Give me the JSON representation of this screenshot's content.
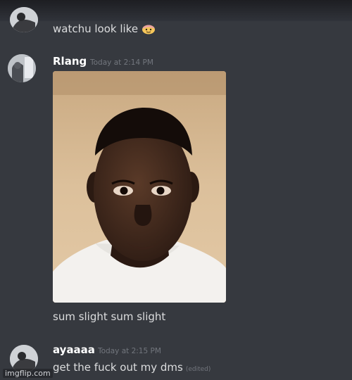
{
  "messages": [
    {
      "text": "watchu look like",
      "emoji": "face-with-party-hat-emoji"
    },
    {
      "username": "Rlang",
      "timestamp": "Today at 2:14 PM",
      "attachment": "selfie-photo",
      "text": "sum slight sum slight"
    },
    {
      "username": "ayaaaa",
      "timestamp": "Today at 2:15 PM",
      "text": "get the fuck out my dms",
      "edited_label": "(edited)"
    }
  ],
  "watermark": "imgflip.com",
  "colors": {
    "background": "#36393f",
    "username": "#ffffff",
    "message_text": "#dcddde",
    "timestamp": "#72767d"
  }
}
